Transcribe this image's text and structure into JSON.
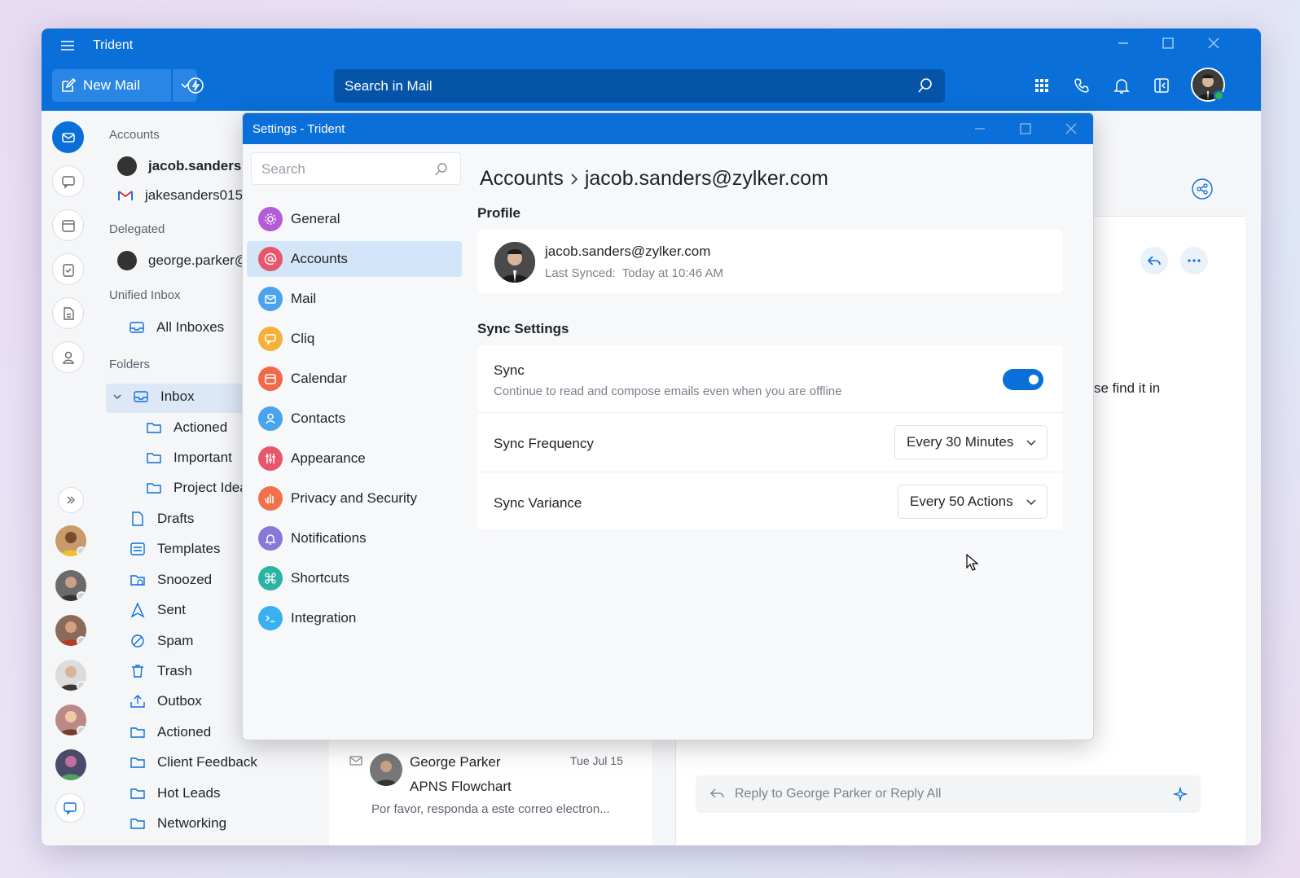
{
  "app": {
    "title": "Trident",
    "new_mail": "New Mail",
    "search_placeholder": "Search in Mail"
  },
  "folder_pane": {
    "accounts_heading": "Accounts",
    "accounts": [
      "jacob.sanders@",
      "jakesanders015("
    ],
    "delegated_heading": "Delegated",
    "delegated": [
      "george.parker@"
    ],
    "unified_heading": "Unified Inbox",
    "all_inboxes": "All Inboxes",
    "folders_heading": "Folders",
    "inbox": "Inbox",
    "subfolders": [
      "Actioned",
      "Important",
      "Project Idea"
    ],
    "folders": [
      "Drafts",
      "Templates",
      "Snoozed",
      "Sent",
      "Spam",
      "Trash",
      "Outbox",
      "Actioned",
      "Client Feedback",
      "Hot Leads",
      "Networking"
    ]
  },
  "mail_list": {
    "sender": "George Parker",
    "date": "Tue Jul 15",
    "subject": "APNS Flowchart",
    "preview": "Por favor, responda a este correo electron..."
  },
  "reading_pane": {
    "snippet": "se find it in",
    "reply_placeholder": "Reply to George Parker or Reply All"
  },
  "settings": {
    "window_title": "Settings - Trident",
    "search_placeholder": "Search",
    "nav": [
      {
        "label": "General",
        "color": "#b45bd6"
      },
      {
        "label": "Accounts",
        "color": "#e8566c"
      },
      {
        "label": "Mail",
        "color": "#4aa3ec"
      },
      {
        "label": "Cliq",
        "color": "#f4b23a"
      },
      {
        "label": "Calendar",
        "color": "#f06a4a"
      },
      {
        "label": "Contacts",
        "color": "#4aa3ec"
      },
      {
        "label": "Appearance",
        "color": "#e8566c"
      },
      {
        "label": "Privacy and Security",
        "color": "#f0714a"
      },
      {
        "label": "Notifications",
        "color": "#8a78d8"
      },
      {
        "label": "Shortcuts",
        "color": "#2bb3a3"
      },
      {
        "label": "Integration",
        "color": "#3ab0f0"
      }
    ],
    "breadcrumb_root": "Accounts",
    "breadcrumb_current": "jacob.sanders@zylker.com",
    "profile_heading": "Profile",
    "profile_email": "jacob.sanders@zylker.com",
    "last_synced_label": "Last Synced:",
    "last_synced_value": "Today at 10:46 AM",
    "sync_heading": "Sync Settings",
    "sync_label": "Sync",
    "sync_desc": "Continue to read and compose emails even when you are offline",
    "sync_enabled": true,
    "frequency_label": "Sync Frequency",
    "frequency_value": "Every 30 Minutes",
    "variance_label": "Sync Variance",
    "variance_value": "Every 50 Actions"
  },
  "colors": {
    "brand": "#0a6fd8",
    "selected": "#d3e5f8"
  }
}
